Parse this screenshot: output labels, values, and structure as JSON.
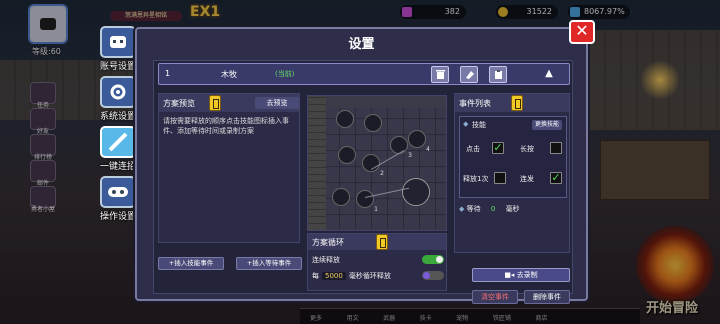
{
  "hud": {
    "level_label": "等级:60",
    "name_tag": "怒满恩异星相铭",
    "ex_label": "EX1",
    "gems": "382",
    "gold": "31522",
    "energy": "8067.97%",
    "side_buttons": [
      "账号设置",
      "系统设置",
      "一键连招",
      "操作设置"
    ],
    "left_icons": [
      "任务",
      "好友",
      "排行榜",
      "邮件",
      "勇者小屋"
    ],
    "bottom_tabs": [
      "更多",
      "用文",
      "武器",
      "技卡",
      "宠物",
      "铁匠铺",
      "商店"
    ],
    "start_adventure": "开始冒险"
  },
  "modal": {
    "title": "设置",
    "close_label": "✕",
    "plan": {
      "number": "1",
      "name": "木牧",
      "current": "(当前)"
    },
    "preview": {
      "title": "方案预览",
      "go_preview": "去预览",
      "description": "请按需要释放的顺序点击技能图标插入事件、添加等待时间或录制方案",
      "insert_skill": "+插入技能事件",
      "insert_wait": "+插入等待事件"
    },
    "map_nodes": [
      "1",
      "2",
      "3",
      "4"
    ],
    "cycle": {
      "title": "方案循环",
      "continuous": "连续释放",
      "every": "每",
      "ms_value": "5000",
      "ms_loop": "毫秒循环释放"
    },
    "events": {
      "title": "事件列表",
      "skill": "技能",
      "more_skill": "更换技能",
      "click": "点击",
      "long_press": "长按",
      "release_once": "释放1次",
      "repeat": "连发",
      "wait": "等待",
      "wait_value": "0",
      "ms": "毫秒"
    },
    "record": "去录制",
    "clear_events": "清空事件",
    "delete_event": "删除事件"
  },
  "colors": {
    "accent": "#f0c828",
    "close": "#e02828",
    "current": "#66e066",
    "clear": "#ff7070"
  }
}
